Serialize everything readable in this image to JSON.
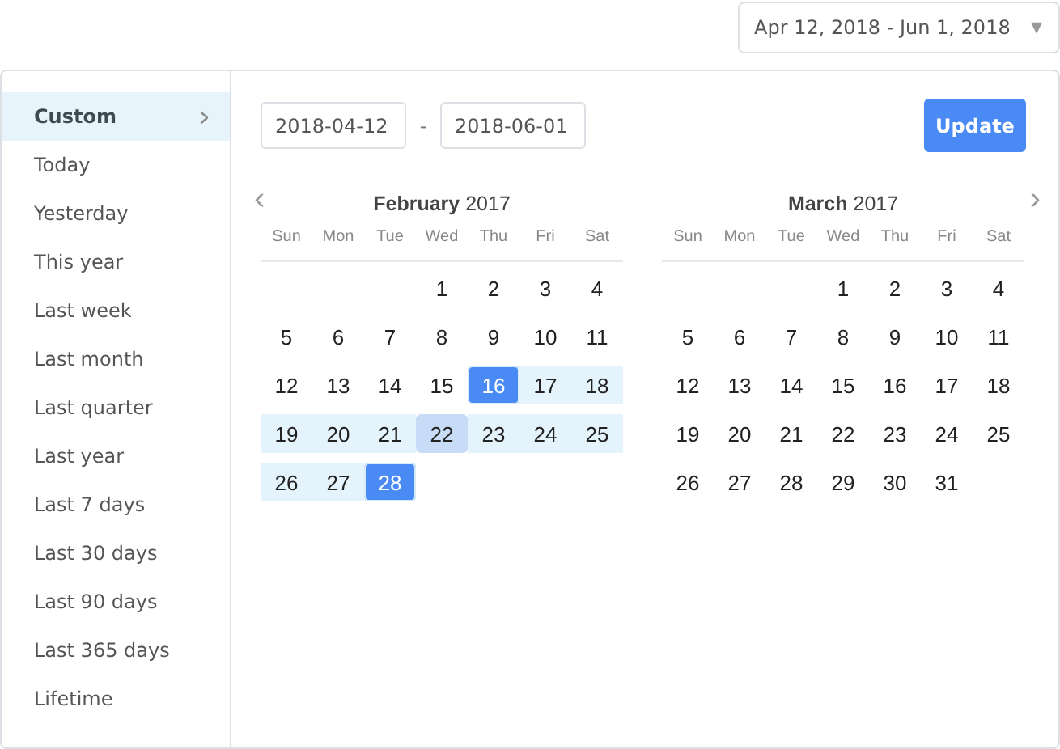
{
  "range_dropdown": {
    "value": "Apr 12, 2018 - Jun 1, 2018",
    "caret": "▾"
  },
  "sidebar": {
    "items": [
      {
        "label": "Custom",
        "selected": true,
        "chevron": "›"
      },
      {
        "label": "Today",
        "selected": false
      },
      {
        "label": "Yesterday",
        "selected": false
      },
      {
        "label": "This year",
        "selected": false
      },
      {
        "label": "Last week",
        "selected": false
      },
      {
        "label": "Last month",
        "selected": false
      },
      {
        "label": "Last quarter",
        "selected": false
      },
      {
        "label": "Last year",
        "selected": false
      },
      {
        "label": "Last 7 days",
        "selected": false
      },
      {
        "label": "Last 30 days",
        "selected": false
      },
      {
        "label": "Last 90 days",
        "selected": false
      },
      {
        "label": "Last 365 days",
        "selected": false
      },
      {
        "label": "Lifetime",
        "selected": false
      }
    ]
  },
  "start_date": "2018-04-12",
  "separator": "-",
  "end_date": "2018-06-01",
  "update_button": "Update",
  "prev_arrow": "‹",
  "next_arrow": "›",
  "months": [
    {
      "month": "February",
      "year": "2017",
      "weekdays": [
        "Sun",
        "Mon",
        "Tue",
        "Wed",
        "Thu",
        "Fri",
        "Sat"
      ],
      "weeks": [
        {
          "kind": "lead",
          "days": [
            {
              "day": "1",
              "selected": false,
              "in_range": false,
              "hovered": false
            },
            {
              "day": "2",
              "selected": false,
              "in_range": false,
              "hovered": false
            },
            {
              "day": "3",
              "selected": false,
              "in_range": false,
              "hovered": false
            },
            {
              "day": "4",
              "selected": false,
              "in_range": false,
              "hovered": false
            }
          ]
        },
        {
          "kind": "full",
          "days": [
            {
              "day": "5",
              "selected": false,
              "in_range": false,
              "hovered": false
            },
            {
              "day": "6",
              "selected": false,
              "in_range": false,
              "hovered": false
            },
            {
              "day": "7",
              "selected": false,
              "in_range": false,
              "hovered": false
            },
            {
              "day": "8",
              "selected": false,
              "in_range": false,
              "hovered": false
            },
            {
              "day": "9",
              "selected": false,
              "in_range": false,
              "hovered": false
            },
            {
              "day": "10",
              "selected": false,
              "in_range": false,
              "hovered": false
            },
            {
              "day": "11",
              "selected": false,
              "in_range": false,
              "hovered": false
            }
          ]
        },
        {
          "kind": "full",
          "days": [
            {
              "day": "12",
              "selected": false,
              "in_range": false,
              "hovered": false
            },
            {
              "day": "13",
              "selected": false,
              "in_range": false,
              "hovered": false
            },
            {
              "day": "14",
              "selected": false,
              "in_range": false,
              "hovered": false
            },
            {
              "day": "15",
              "selected": false,
              "in_range": false,
              "hovered": false
            },
            {
              "day": "16",
              "selected": true,
              "in_range": true,
              "hovered": false
            },
            {
              "day": "17",
              "selected": false,
              "in_range": true,
              "hovered": false
            },
            {
              "day": "18",
              "selected": false,
              "in_range": true,
              "hovered": false
            }
          ]
        },
        {
          "kind": "full",
          "days": [
            {
              "day": "19",
              "selected": false,
              "in_range": true,
              "hovered": false
            },
            {
              "day": "20",
              "selected": false,
              "in_range": true,
              "hovered": false
            },
            {
              "day": "21",
              "selected": false,
              "in_range": true,
              "hovered": false
            },
            {
              "day": "22",
              "selected": false,
              "in_range": true,
              "hovered": true
            },
            {
              "day": "23",
              "selected": false,
              "in_range": true,
              "hovered": false
            },
            {
              "day": "24",
              "selected": false,
              "in_range": true,
              "hovered": false
            },
            {
              "day": "25",
              "selected": false,
              "in_range": true,
              "hovered": false
            }
          ]
        },
        {
          "kind": "trail",
          "days": [
            {
              "day": "26",
              "selected": false,
              "in_range": true,
              "hovered": false
            },
            {
              "day": "27",
              "selected": false,
              "in_range": true,
              "hovered": false
            },
            {
              "day": "28",
              "selected": true,
              "in_range": true,
              "hovered": false
            }
          ]
        }
      ]
    },
    {
      "month": "March",
      "year": "2017",
      "weekdays": [
        "Sun",
        "Mon",
        "Tue",
        "Wed",
        "Thu",
        "Fri",
        "Sat"
      ],
      "weeks": [
        {
          "kind": "lead",
          "days": [
            {
              "day": "1",
              "selected": false,
              "in_range": false,
              "hovered": false
            },
            {
              "day": "2",
              "selected": false,
              "in_range": false,
              "hovered": false
            },
            {
              "day": "3",
              "selected": false,
              "in_range": false,
              "hovered": false
            },
            {
              "day": "4",
              "selected": false,
              "in_range": false,
              "hovered": false
            }
          ]
        },
        {
          "kind": "full",
          "days": [
            {
              "day": "5",
              "selected": false,
              "in_range": false,
              "hovered": false
            },
            {
              "day": "6",
              "selected": false,
              "in_range": false,
              "hovered": false
            },
            {
              "day": "7",
              "selected": false,
              "in_range": false,
              "hovered": false
            },
            {
              "day": "8",
              "selected": false,
              "in_range": false,
              "hovered": false
            },
            {
              "day": "9",
              "selected": false,
              "in_range": false,
              "hovered": false
            },
            {
              "day": "10",
              "selected": false,
              "in_range": false,
              "hovered": false
            },
            {
              "day": "11",
              "selected": false,
              "in_range": false,
              "hovered": false
            }
          ]
        },
        {
          "kind": "full",
          "days": [
            {
              "day": "12",
              "selected": false,
              "in_range": false,
              "hovered": false
            },
            {
              "day": "13",
              "selected": false,
              "in_range": false,
              "hovered": false
            },
            {
              "day": "14",
              "selected": false,
              "in_range": false,
              "hovered": false
            },
            {
              "day": "15",
              "selected": false,
              "in_range": false,
              "hovered": false
            },
            {
              "day": "16",
              "selected": false,
              "in_range": false,
              "hovered": false
            },
            {
              "day": "17",
              "selected": false,
              "in_range": false,
              "hovered": false
            },
            {
              "day": "18",
              "selected": false,
              "in_range": false,
              "hovered": false
            }
          ]
        },
        {
          "kind": "full",
          "days": [
            {
              "day": "19",
              "selected": false,
              "in_range": false,
              "hovered": false
            },
            {
              "day": "20",
              "selected": false,
              "in_range": false,
              "hovered": false
            },
            {
              "day": "21",
              "selected": false,
              "in_range": false,
              "hovered": false
            },
            {
              "day": "22",
              "selected": false,
              "in_range": false,
              "hovered": false
            },
            {
              "day": "23",
              "selected": false,
              "in_range": false,
              "hovered": false
            },
            {
              "day": "24",
              "selected": false,
              "in_range": false,
              "hovered": false
            },
            {
              "day": "25",
              "selected": false,
              "in_range": false,
              "hovered": false
            }
          ]
        },
        {
          "kind": "trail",
          "days": [
            {
              "day": "26",
              "selected": false,
              "in_range": false,
              "hovered": false
            },
            {
              "day": "27",
              "selected": false,
              "in_range": false,
              "hovered": false
            },
            {
              "day": "28",
              "selected": false,
              "in_range": false,
              "hovered": false
            },
            {
              "day": "29",
              "selected": false,
              "in_range": false,
              "hovered": false
            },
            {
              "day": "30",
              "selected": false,
              "in_range": false,
              "hovered": false
            },
            {
              "day": "31",
              "selected": false,
              "in_range": false,
              "hovered": false
            }
          ]
        }
      ]
    }
  ]
}
